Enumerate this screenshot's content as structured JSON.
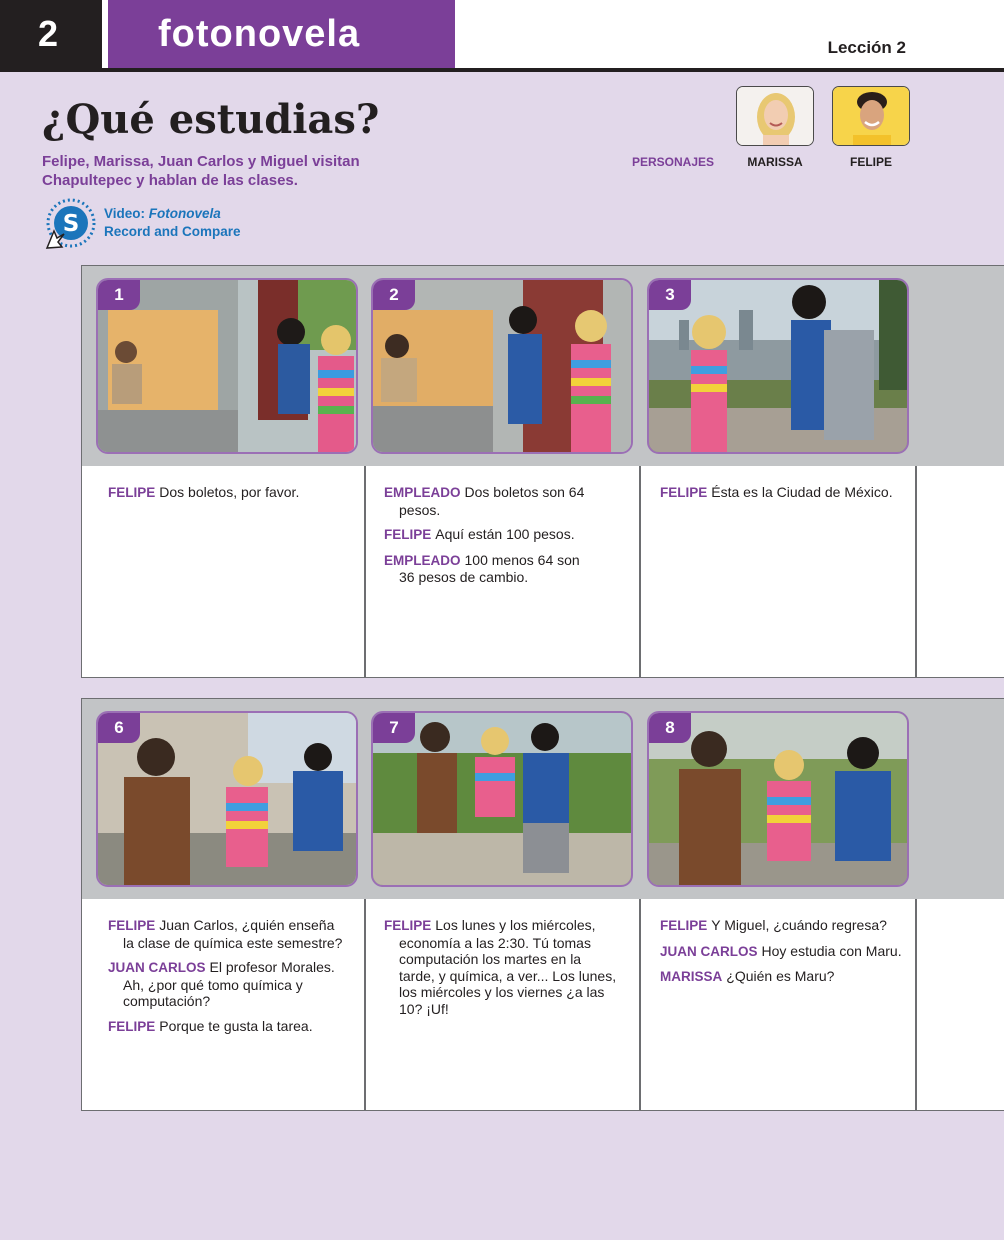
{
  "header": {
    "chapter_number": "2",
    "section_title": "fotonovela",
    "lesson": "Lección 2"
  },
  "title": "¿Qué estudias?",
  "subtitle": "Felipe, Marissa, Juan Carlos y Miguel visitan Chapultepec y hablan de las clases.",
  "video": {
    "icon_letter": "S",
    "label_prefix": "Video:",
    "label_italic": "Fotonovela",
    "label2": "Record and Compare"
  },
  "personajes": {
    "label": "PERSONAJES",
    "characters": [
      {
        "name": "MARISSA"
      },
      {
        "name": "FELIPE"
      }
    ]
  },
  "strips": [
    {
      "panels": [
        {
          "number": "1",
          "lines": [
            {
              "speaker": "FELIPE",
              "text": "Dos boletos, por favor."
            }
          ]
        },
        {
          "number": "2",
          "lines": [
            {
              "speaker": "EMPLEADO",
              "text": "Dos boletos son 64 pesos."
            },
            {
              "speaker": "FELIPE",
              "text": "Aquí están 100 pesos."
            },
            {
              "speaker": "EMPLEADO",
              "text": "100 menos 64 son 36 pesos de cambio."
            }
          ]
        },
        {
          "number": "3",
          "lines": [
            {
              "speaker": "FELIPE",
              "text": "Ésta es la Ciudad de México."
            }
          ]
        }
      ]
    },
    {
      "panels": [
        {
          "number": "6",
          "lines": [
            {
              "speaker": "FELIPE",
              "text": "Juan Carlos, ¿quién enseña la clase de química este semestre?"
            },
            {
              "speaker": "JUAN CARLOS",
              "text": "El profesor Morales. Ah, ¿por qué tomo química y computación?"
            },
            {
              "speaker": "FELIPE",
              "text": "Porque te gusta la tarea."
            }
          ]
        },
        {
          "number": "7",
          "lines": [
            {
              "speaker": "FELIPE",
              "text": "Los lunes y los miércoles, economía a las 2:30. Tú tomas computación los martes en la tarde, y química, a ver... Los lunes, los miércoles y los viernes ¿a las 10? ¡Uf!"
            }
          ]
        },
        {
          "number": "8",
          "lines": [
            {
              "speaker": "FELIPE",
              "text": "Y Miguel, ¿cuándo regresa?"
            },
            {
              "speaker": "JUAN CARLOS",
              "text": "Hoy estudia con Maru."
            },
            {
              "speaker": "MARISSA",
              "text": "¿Quién es Maru?"
            }
          ]
        }
      ]
    }
  ],
  "colors": {
    "accent_purple": "#7b3f98",
    "page_background": "#e2d8ea",
    "band_gray": "#c2c4c6",
    "link_blue": "#1b75bb"
  }
}
